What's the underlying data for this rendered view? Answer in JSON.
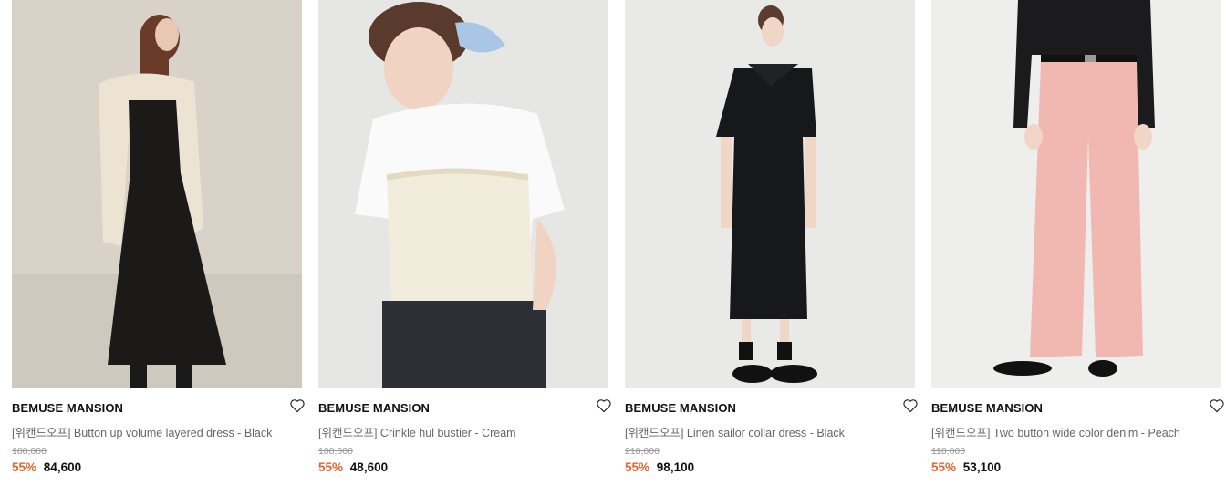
{
  "products": [
    {
      "brand": "BEMUSE MANSION",
      "title": "[위캔드오프] Button up volume layered dress - Black",
      "original_price": "188,000",
      "discount": "55%",
      "sale_price": "84,600",
      "image_colors": {
        "bg": "#d8d2c9",
        "garment": "#1c1a18",
        "accent": "#ece3d3"
      }
    },
    {
      "brand": "BEMUSE MANSION",
      "title": "[위캔드오프] Crinkle hul bustier - Cream",
      "original_price": "108,000",
      "discount": "55%",
      "sale_price": "48,600",
      "image_colors": {
        "bg": "#e6e6e4",
        "garment": "#f2ecdc",
        "accent": "#2c2f36"
      }
    },
    {
      "brand": "BEMUSE MANSION",
      "title": "[위캔드오프] Linen sailor collar dress - Black",
      "original_price": "218,000",
      "discount": "55%",
      "sale_price": "98,100",
      "image_colors": {
        "bg": "#e9e9e7",
        "garment": "#16181c",
        "accent": "#202020"
      }
    },
    {
      "brand": "BEMUSE MANSION",
      "title": "[위캔드오프] Two button wide color denim - Peach",
      "original_price": "118,000",
      "discount": "55%",
      "sale_price": "53,100",
      "image_colors": {
        "bg": "#eeeeec",
        "garment": "#f1b8b2",
        "accent": "#1b1b1d"
      }
    }
  ],
  "icons": {
    "wishlist": "heart-outline-icon"
  },
  "colors": {
    "discount": "#e8632b",
    "text": "#111111",
    "muted": "#666666"
  }
}
